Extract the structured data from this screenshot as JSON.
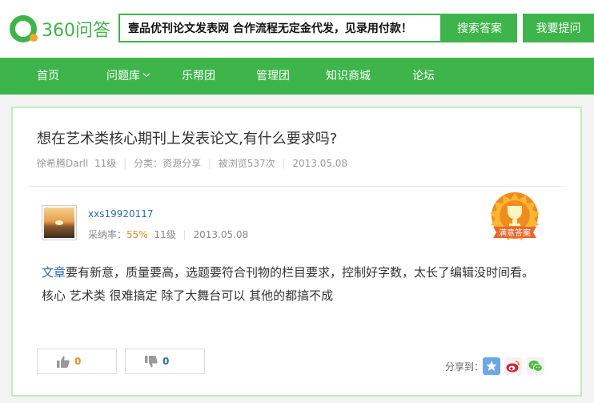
{
  "header": {
    "logo_text": "360问答",
    "search_value": "壹品优刊论文发表网   合作流程无定金代发，见录用付款！",
    "search_button": "搜索答案",
    "ask_button": "我要提问"
  },
  "nav": {
    "items": [
      {
        "label": "首页"
      },
      {
        "label": "问题库"
      },
      {
        "label": "乐帮团"
      },
      {
        "label": "管理团"
      },
      {
        "label": "知识商城"
      },
      {
        "label": "论坛"
      }
    ]
  },
  "question": {
    "title": "想在艺术类核心期刊上发表论文,有什么要求吗?",
    "author": "徐希腾Darll",
    "level": "11级",
    "category": "分类：资源分享",
    "views": "被浏览537次",
    "date": "2013.05.08"
  },
  "answer": {
    "username": "xxs19920117",
    "rate_label": "采纳率：",
    "rate_value": "55%",
    "level": "11级",
    "date": "2013.05.08",
    "badge_text": "满意答案",
    "link_text": "文章",
    "line1_rest": "要有新意，质量要高，选题要符合刊物的栏目要求，控制好字数，太长了编辑没时间看。",
    "line2": "核心 艺术类  很难搞定 除了大舞台可以 其他的都搞不成",
    "upvotes": "0",
    "downvotes": "0"
  },
  "share": {
    "label": "分享到："
  },
  "colors": {
    "brand_green": "#3db54a",
    "link_blue": "#2a6db8",
    "accent_orange": "#f08c1e"
  }
}
